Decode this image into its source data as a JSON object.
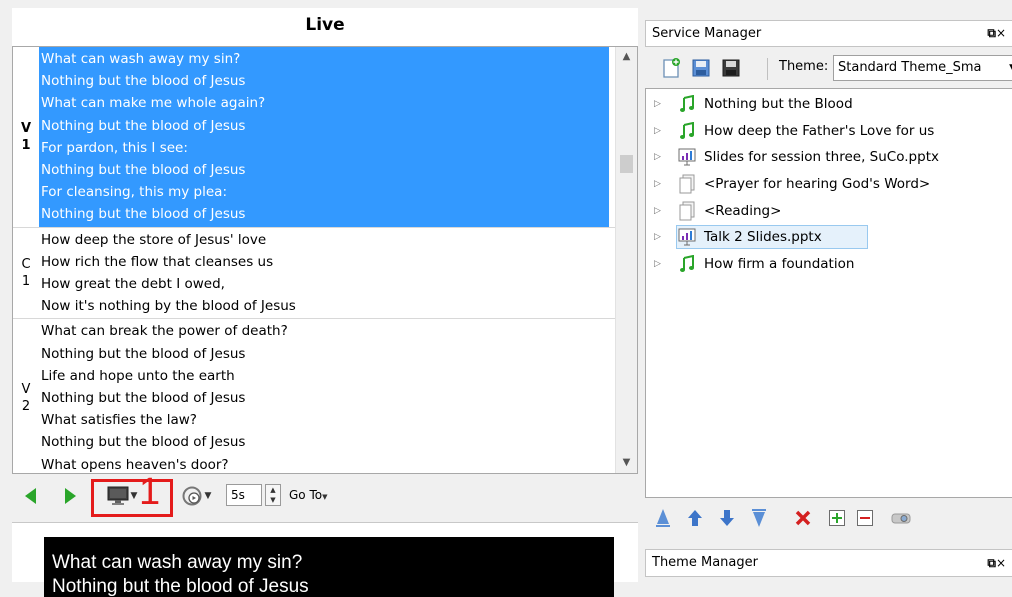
{
  "live": {
    "title": "Live",
    "verses": [
      {
        "tag": [
          "V",
          "1"
        ],
        "selected": true,
        "lines": [
          "What can wash away my sin?",
          "Nothing but the blood of Jesus",
          "What can make me whole again?",
          "Nothing but the blood of Jesus",
          "For pardon, this I see:",
          "Nothing but the blood of Jesus",
          "For cleansing, this my plea:",
          "Nothing but the blood of Jesus"
        ]
      },
      {
        "tag": [
          "C",
          "1"
        ],
        "selected": false,
        "lines": [
          "How deep the store of Jesus' love",
          "How rich the flow that cleanses us",
          "How great the debt I owed,",
          "Now it's nothing by the blood of Jesus"
        ]
      },
      {
        "tag": [
          "V",
          "2"
        ],
        "selected": false,
        "lines": [
          "What can break the power of death?",
          "Nothing but the blood of Jesus",
          "Life and hope unto the earth",
          "Nothing but the blood of Jesus",
          "What satisfies the law?",
          "Nothing but the blood of Jesus",
          "What opens heaven's door?"
        ]
      }
    ],
    "toolbar": {
      "annotation": "1",
      "delay": "5s",
      "goto_label": "Go To"
    },
    "preview_text": "What can wash away my sin?",
    "preview_text_2": "Nothing but the blood of Jesus"
  },
  "service_manager": {
    "title": "Service Manager",
    "theme_label": "Theme:",
    "theme_value": "Standard Theme_Sma",
    "items": [
      {
        "label": "Nothing but the Blood",
        "icon": "music-note-icon",
        "selected": false
      },
      {
        "label": "How deep the Father's Love for us",
        "icon": "music-note-icon",
        "selected": false
      },
      {
        "label": "Slides for session three, SuCo.pptx",
        "icon": "presentation-icon",
        "selected": false
      },
      {
        "label": "<Prayer for hearing God's Word>",
        "icon": "custom-slide-icon",
        "selected": false
      },
      {
        "label": "<Reading>",
        "icon": "custom-slide-icon",
        "selected": false
      },
      {
        "label": "Talk 2 Slides.pptx",
        "icon": "presentation-icon",
        "selected": true
      },
      {
        "label": "How firm a foundation",
        "icon": "music-note-icon",
        "selected": false
      }
    ]
  },
  "theme_manager": {
    "title": "Theme Manager"
  },
  "colors": {
    "selection": "#3399ff",
    "song_icon": "#2aa52a",
    "annotation": "#e41b1b",
    "delete_icon": "#d42020"
  }
}
